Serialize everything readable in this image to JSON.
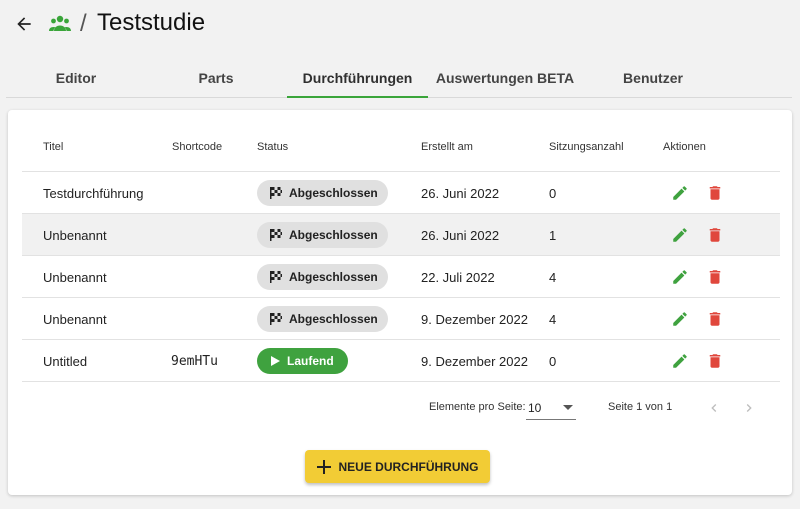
{
  "header": {
    "separator": "/",
    "title": "Teststudie"
  },
  "tabs": [
    {
      "label": "Editor"
    },
    {
      "label": "Parts"
    },
    {
      "label": "Durchführungen"
    },
    {
      "label": "Auswertungen BETA"
    },
    {
      "label": "Benutzer"
    }
  ],
  "active_tab": "Durchführungen",
  "colors": {
    "accent_green": "#3aa53a",
    "delete_red": "#e0473c",
    "edit_green": "#3fa23f",
    "button_yellow": "#f2cc35"
  },
  "table": {
    "columns": [
      "Titel",
      "Shortcode",
      "Status",
      "Erstellt am",
      "Sitzungsanzahl",
      "Aktionen"
    ],
    "rows": [
      {
        "title": "Testdurchführung",
        "shortcode": "",
        "status": "Abgeschlossen",
        "status_icon": "checkered-flag-icon",
        "created": "26. Juni 2022",
        "sessions": "0"
      },
      {
        "title": "Unbenannt",
        "shortcode": "",
        "status": "Abgeschlossen",
        "status_icon": "checkered-flag-icon",
        "created": "26. Juni 2022",
        "sessions": "1"
      },
      {
        "title": "Unbenannt",
        "shortcode": "",
        "status": "Abgeschlossen",
        "status_icon": "checkered-flag-icon",
        "created": "22. Juli 2022",
        "sessions": "4"
      },
      {
        "title": "Unbenannt",
        "shortcode": "",
        "status": "Abgeschlossen",
        "status_icon": "checkered-flag-icon",
        "created": "9. Dezember 2022",
        "sessions": "4"
      },
      {
        "title": "Untitled",
        "shortcode": "9emHTu",
        "status": "Laufend",
        "status_icon": "play-icon",
        "created": "9. Dezember 2022",
        "sessions": "0"
      }
    ]
  },
  "pagination": {
    "per_page_label": "Elemente pro Seite:",
    "per_page_value": "10",
    "page_info": "Seite 1 von 1"
  },
  "new_button": {
    "label": "NEUE DURCHFÜHRUNG"
  }
}
